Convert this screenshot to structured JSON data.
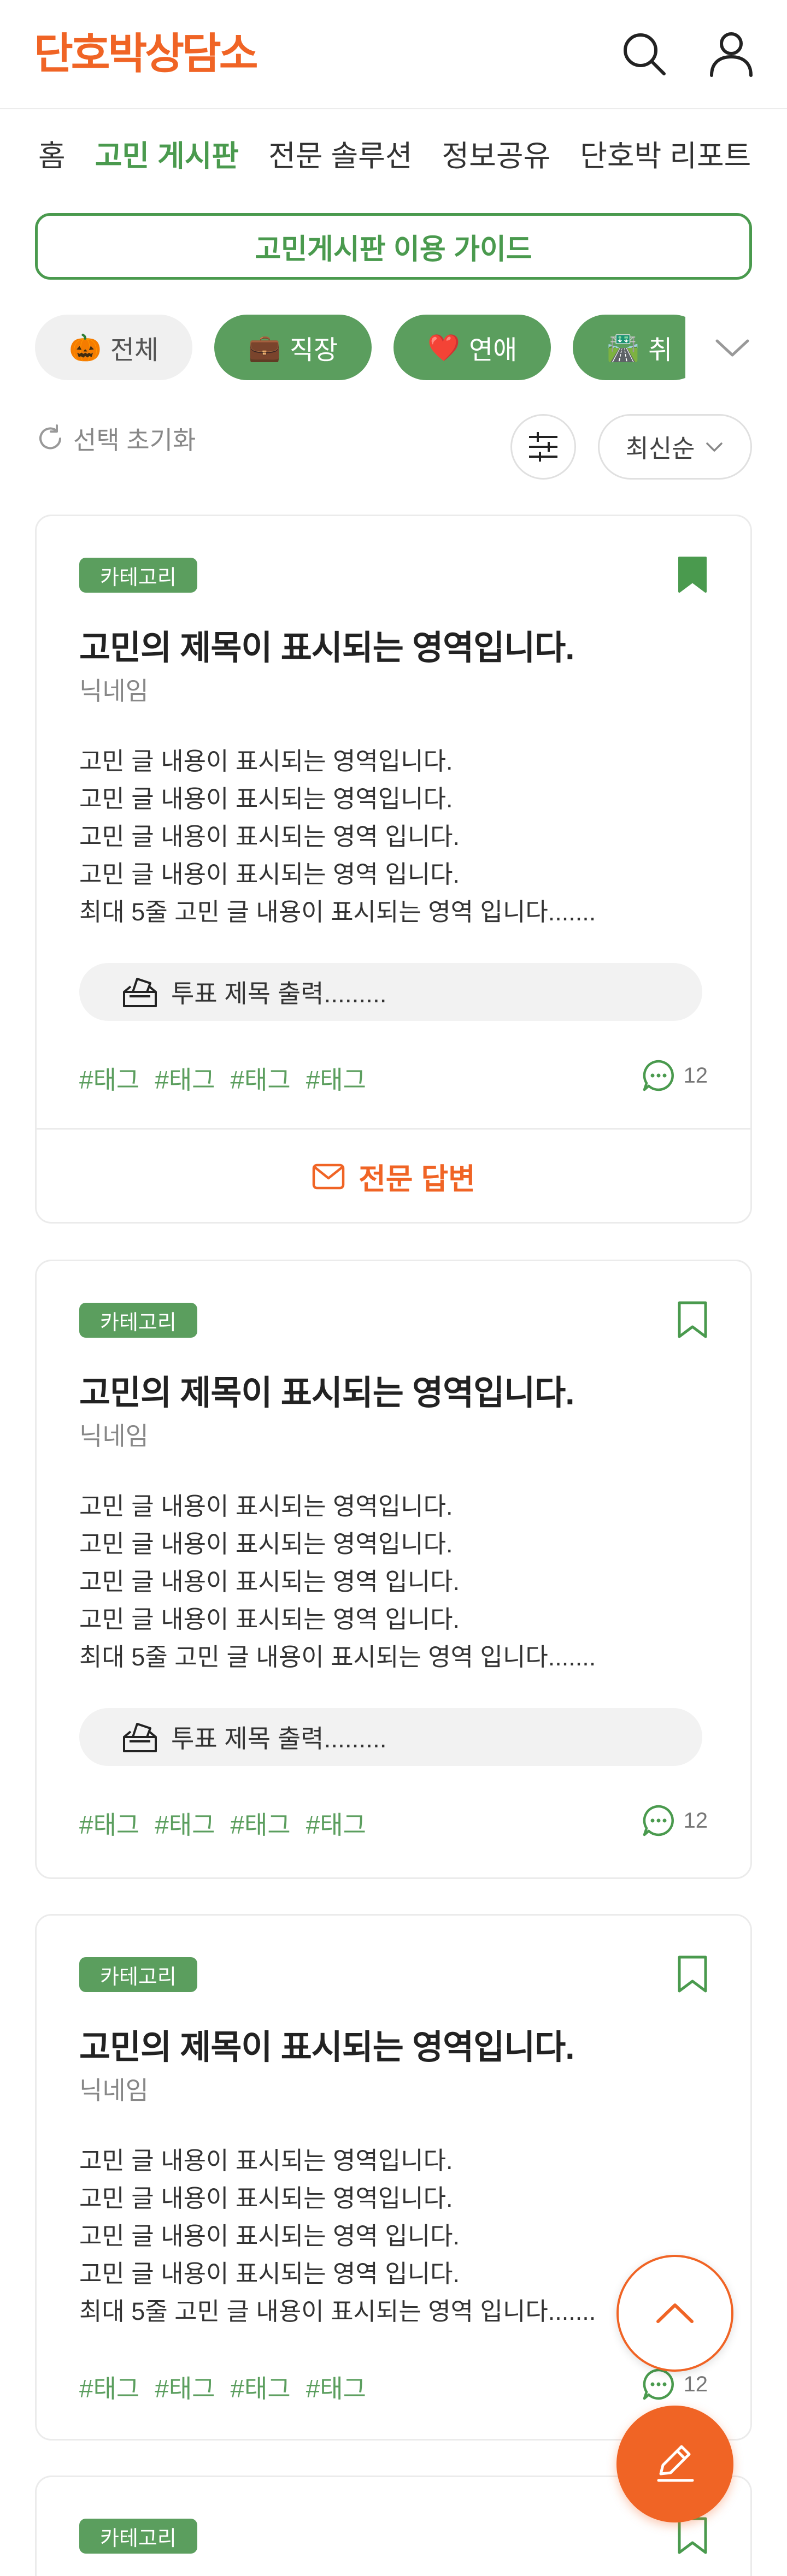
{
  "header": {
    "logo_text": "단호박상담소",
    "brand_color": "#f06425",
    "icons": [
      "search-icon",
      "user-icon"
    ]
  },
  "nav": {
    "items": [
      {
        "label": "홈",
        "active": false
      },
      {
        "label": "고민 게시판",
        "active": true
      },
      {
        "label": "전문 솔루션",
        "active": false
      },
      {
        "label": "정보공유",
        "active": false
      },
      {
        "label": "단호박 리포트",
        "active": false
      }
    ],
    "accent_color": "#4a9a4e"
  },
  "guide_button": {
    "label": "고민게시판 이용 가이드"
  },
  "categories": [
    {
      "emoji": "🎃",
      "label": "전체",
      "selected": false
    },
    {
      "emoji": "💼",
      "label": "직장",
      "selected": true
    },
    {
      "emoji": "❤️",
      "label": "연애",
      "selected": true
    },
    {
      "emoji": "🛣️",
      "label": "취",
      "selected": true
    }
  ],
  "toolbar": {
    "reset_label": "선택 초기화",
    "sort_label": "최신순"
  },
  "posts": [
    {
      "category": "카테고리",
      "title": "고민의 제목이 표시되는 영역입니다.",
      "nickname": "닉네임",
      "body": [
        "고민 글 내용이 표시되는 영역입니다.",
        "고민 글 내용이 표시되는 영역입니다.",
        "고민 글 내용이 표시되는 영역 입니다.",
        "고민 글 내용이 표시되는 영역 입니다.",
        "최대 5줄 고민 글 내용이 표시되는 영역 입니다......."
      ],
      "vote": "투표 제목 출력.........",
      "tags": [
        "#태그",
        "#태그",
        "#태그",
        "#태그"
      ],
      "comment_count": "12",
      "bookmarked": true,
      "expert_label": "전문 답변"
    },
    {
      "category": "카테고리",
      "title": "고민의 제목이 표시되는 영역입니다.",
      "nickname": "닉네임",
      "body": [
        "고민 글 내용이 표시되는 영역입니다.",
        "고민 글 내용이 표시되는 영역입니다.",
        "고민 글 내용이 표시되는 영역 입니다.",
        "고민 글 내용이 표시되는 영역 입니다.",
        "최대 5줄 고민 글 내용이 표시되는 영역 입니다......."
      ],
      "vote": "투표 제목 출력.........",
      "tags": [
        "#태그",
        "#태그",
        "#태그",
        "#태그"
      ],
      "comment_count": "12",
      "bookmarked": false
    },
    {
      "category": "카테고리",
      "title": "고민의 제목이 표시되는 영역입니다.",
      "nickname": "닉네임",
      "body": [
        "고민 글 내용이 표시되는 영역입니다.",
        "고민 글 내용이 표시되는 영역입니다.",
        "고민 글 내용이 표시되는 영역 입니다.",
        "고민 글 내용이 표시되는 영역 입니다.",
        "최대 5줄 고민 글 내용이 표시되는 영역 입니다......."
      ],
      "tags": [
        "#태그",
        "#태그",
        "#태그",
        "#태그"
      ],
      "comment_count": "12",
      "bookmarked": false
    },
    {
      "category": "카테고리",
      "bookmarked": false
    }
  ],
  "floating_buttons": [
    "chevron-up-icon",
    "pencil-icon"
  ]
}
